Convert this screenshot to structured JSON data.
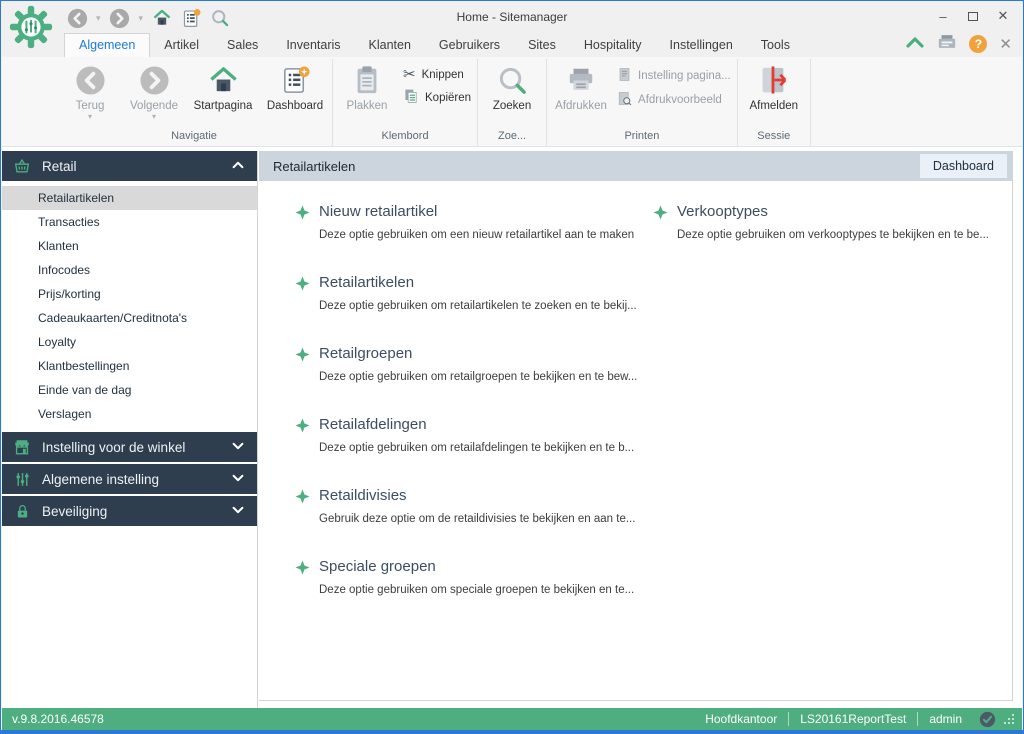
{
  "icons": {
    "minimize": "–",
    "close": "✕",
    "help": "?",
    "scissors": "✂",
    "dropdown_caret": "▾"
  },
  "titlebar": {
    "title": "Home - Sitemanager"
  },
  "tabs": [
    {
      "label": "Algemeen",
      "active": true
    },
    {
      "label": "Artikel"
    },
    {
      "label": "Sales"
    },
    {
      "label": "Inventaris"
    },
    {
      "label": "Klanten"
    },
    {
      "label": "Gebruikers"
    },
    {
      "label": "Sites"
    },
    {
      "label": "Hospitality"
    },
    {
      "label": "Instellingen"
    },
    {
      "label": "Tools"
    }
  ],
  "ribbon": {
    "groups": [
      {
        "label": "Navigatie",
        "buttons": [
          {
            "label": "Terug",
            "enabled": false,
            "has_dropdown": true
          },
          {
            "label": "Volgende",
            "enabled": false,
            "has_dropdown": true
          },
          {
            "label": "Startpagina",
            "enabled": true
          },
          {
            "label": "Dashboard",
            "enabled": true
          }
        ]
      },
      {
        "label": "Klembord",
        "buttons": [
          {
            "label": "Plakken",
            "enabled": false
          },
          {
            "label": "Knippen",
            "enabled": true
          },
          {
            "label": "Kopiëren",
            "enabled": true
          }
        ]
      },
      {
        "label": "Zoe...",
        "buttons": [
          {
            "label": "Zoeken",
            "enabled": true
          }
        ]
      },
      {
        "label": "Printen",
        "buttons": [
          {
            "label": "Afdrukken",
            "enabled": false
          },
          {
            "label": "Instelling pagina...",
            "enabled": false
          },
          {
            "label": "Afdrukvoorbeeld",
            "enabled": false
          }
        ]
      },
      {
        "label": "Sessie",
        "buttons": [
          {
            "label": "Afmelden",
            "enabled": true
          }
        ]
      }
    ]
  },
  "sidebar": {
    "sections": [
      {
        "label": "Retail",
        "state": "expanded",
        "items": [
          {
            "label": "Retailartikelen",
            "selected": true
          },
          {
            "label": "Transacties"
          },
          {
            "label": "Klanten"
          },
          {
            "label": "Infocodes"
          },
          {
            "label": "Prijs/korting"
          },
          {
            "label": "Cadeaukaarten/Creditnota's"
          },
          {
            "label": "Loyalty"
          },
          {
            "label": "Klantbestellingen"
          },
          {
            "label": "Einde van de dag"
          },
          {
            "label": "Verslagen"
          }
        ]
      },
      {
        "label": "Instelling voor de winkel",
        "state": "collapsed"
      },
      {
        "label": "Algemene instelling",
        "state": "collapsed"
      },
      {
        "label": "Beveiliging",
        "state": "collapsed"
      }
    ]
  },
  "content": {
    "header": {
      "title": "Retailartikelen",
      "action_label": "Dashboard"
    },
    "left_items": [
      {
        "title": "Nieuw retailartikel",
        "description": "Deze optie gebruiken om een nieuw retailartikel aan te maken"
      },
      {
        "title": "Retailartikelen",
        "description": "Deze optie gebruiken om retailartikelen te zoeken en te bekij..."
      },
      {
        "title": "Retailgroepen",
        "description": "Deze optie gebruiken om retailgroepen te bekijken en te bew..."
      },
      {
        "title": "Retailafdelingen",
        "description": "Deze optie gebruiken om retailafdelingen te bekijken en te b..."
      },
      {
        "title": "Retaildivisies",
        "description": "Gebruik deze optie om de retaildivisies te bekijken en aan te..."
      },
      {
        "title": "Speciale groepen",
        "description": "Deze optie gebruiken om speciale groepen te bekijken en te..."
      }
    ],
    "right_items": [
      {
        "title": "Verkooptypes",
        "description": "Deze optie gebruiken om verkooptypes te bekijken en te be..."
      }
    ]
  },
  "statusbar": {
    "version": "v.9.8.2016.46578",
    "items": [
      "Hoofdkantoor",
      "LS20161ReportTest",
      "admin"
    ]
  },
  "colors": {
    "accent_green": "#4CAF82",
    "sidebar_dark": "#2F3E4E",
    "statusbar_green": "#4FAE7F",
    "active_tab_blue": "#1E7AD4",
    "badge_orange": "#F0A33C",
    "afmelden_red": "#E23D32",
    "window_border_blue": "#2A7AD2"
  }
}
